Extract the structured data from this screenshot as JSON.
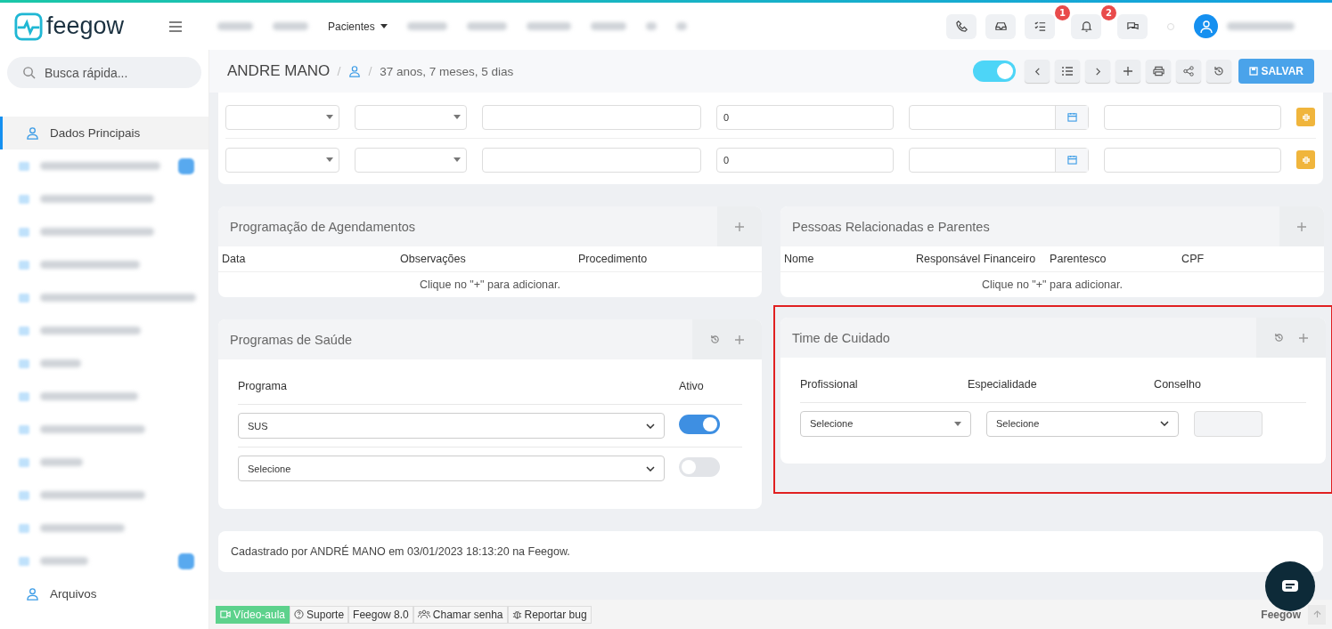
{
  "brand": {
    "name": "feegow"
  },
  "nav": [
    {
      "kind": "blurred"
    },
    {
      "kind": "blurred"
    },
    {
      "kind": "dropdown",
      "label": "Pacientes"
    },
    {
      "kind": "blurred"
    },
    {
      "kind": "blurred"
    },
    {
      "kind": "blurred"
    },
    {
      "kind": "blurred"
    },
    {
      "kind": "blurred"
    },
    {
      "kind": "blurred"
    }
  ],
  "header_badges": {
    "tasks": "1",
    "notifications": "2"
  },
  "sidebar": {
    "search": {
      "placeholder": "Busca rápida..."
    },
    "items": [
      {
        "kind": "link",
        "label": "Dados Principais",
        "selected": true
      },
      {
        "kind": "blurred",
        "badge": true,
        "selected": false
      },
      {
        "kind": "blurred",
        "badge": false,
        "selected": false
      },
      {
        "kind": "blurred",
        "badge": false,
        "selected": false
      },
      {
        "kind": "blurred",
        "badge": false,
        "selected": false
      },
      {
        "kind": "blurred",
        "badge": false,
        "selected": false
      },
      {
        "kind": "blurred",
        "badge": false,
        "selected": false
      },
      {
        "kind": "blurred",
        "badge": false,
        "selected": false
      },
      {
        "kind": "blurred",
        "badge": false,
        "selected": false
      },
      {
        "kind": "blurred",
        "badge": false,
        "selected": false
      },
      {
        "kind": "blurred",
        "badge": false,
        "selected": false
      },
      {
        "kind": "blurred",
        "badge": false,
        "selected": false
      },
      {
        "kind": "blurred",
        "badge": false,
        "selected": false
      },
      {
        "kind": "blurred",
        "badge": true,
        "selected": false
      },
      {
        "kind": "link",
        "label": "Arquivos",
        "selected": false
      }
    ]
  },
  "patient": {
    "name": "ANDRE MANO",
    "age": "37 anos, 7 meses, 5 dias",
    "toggle_on": true,
    "save_label": "SALVAR"
  },
  "grid_rows": [
    {
      "number": "0"
    },
    {
      "number": "0"
    }
  ],
  "panels": [
    {
      "kind": "table",
      "title": "Programação de Agendamentos",
      "columns": [
        "Data",
        "Observações",
        "Procedimento"
      ],
      "empty": "Clique no  \"+\" para adicionar.",
      "highlighted": false
    },
    {
      "kind": "table",
      "title": "Pessoas Relacionadas e Parentes",
      "columns": [
        "Nome",
        "Responsável Financeiro",
        "Parentesco",
        "CPF"
      ],
      "empty": "Clique no  \"+\" para adicionar.",
      "highlighted": false
    },
    {
      "kind": "programs",
      "title": "Programas de Saúde",
      "columns": [
        "Programa",
        "Ativo"
      ],
      "rows": [
        {
          "value": "SUS",
          "on": true
        },
        {
          "value": "Selecione",
          "on": false
        }
      ],
      "highlighted": false
    },
    {
      "kind": "team",
      "title": "Time de Cuidado",
      "columns": [
        "Profissional",
        "Especialidade",
        "Conselho"
      ],
      "selects": [
        "Selecione",
        "Selecione"
      ],
      "highlighted": true
    }
  ],
  "note": "Cadastrado por ANDRÉ MANO em 03/01/2023 18:13:20 na Feegow.",
  "status_bar": {
    "items": [
      {
        "kind": "video",
        "label": "Vídeo-aula"
      },
      {
        "kind": "help",
        "label": "Suporte"
      },
      {
        "kind": "plain",
        "label": "Feegow 8.0"
      },
      {
        "kind": "people",
        "label": "Chamar senha"
      },
      {
        "kind": "bug",
        "label": "Reportar bug"
      }
    ],
    "brand": "Feegow"
  }
}
